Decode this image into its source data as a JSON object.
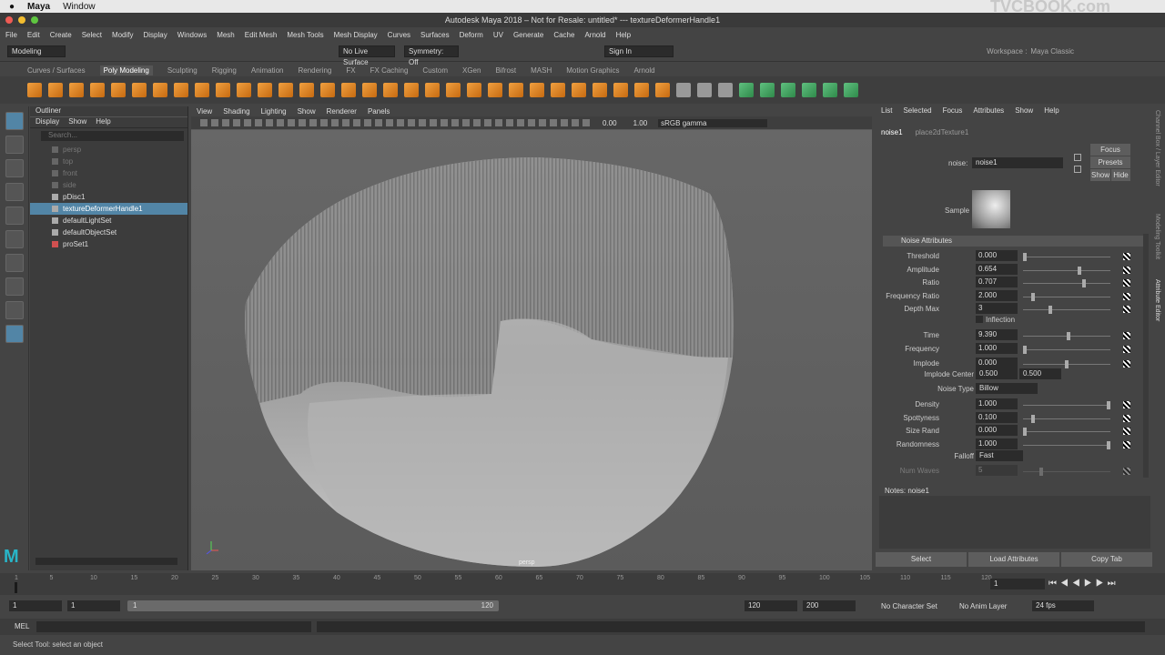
{
  "os_menu": {
    "app": "Maya",
    "window": "Window"
  },
  "title": "Autodesk Maya 2018 – Not for Resale: untitled*   ---   textureDeformerHandle1",
  "watermark": "TVCBOOK.com",
  "menu": [
    "File",
    "Edit",
    "Create",
    "Select",
    "Modify",
    "Display",
    "Windows",
    "Mesh",
    "Edit Mesh",
    "Mesh Tools",
    "Mesh Display",
    "Curves",
    "Surfaces",
    "Deform",
    "UV",
    "Generate",
    "Cache",
    "Arnold",
    "Help"
  ],
  "status": {
    "mode": "Modeling",
    "live": "No Live Surface",
    "symmetry": "Symmetry: Off",
    "signin": "Sign In",
    "workspace": "Workspace :",
    "workspace_val": "Maya Classic"
  },
  "shelf_tabs": [
    "Curves / Surfaces",
    "Poly Modeling",
    "Sculpting",
    "Rigging",
    "Animation",
    "Rendering",
    "FX",
    "FX Caching",
    "Custom",
    "XGen",
    "Bifrost",
    "MASH",
    "Motion Graphics",
    "Arnold"
  ],
  "outliner": {
    "title": "Outliner",
    "menu": [
      "Display",
      "Show",
      "Help"
    ],
    "search": "Search...",
    "items": [
      "persp",
      "top",
      "front",
      "side",
      "pDisc1",
      "textureDeformerHandle1",
      "defaultLightSet",
      "defaultObjectSet",
      "proSet1"
    ]
  },
  "viewport": {
    "menu": [
      "View",
      "Shading",
      "Lighting",
      "Show",
      "Renderer",
      "Panels"
    ],
    "v1": "0.00",
    "v2": "1.00",
    "colorspace": "sRGB gamma",
    "camera": "persp"
  },
  "attr_editor": {
    "menu": [
      "List",
      "Selected",
      "Focus",
      "Attributes",
      "Show",
      "Help"
    ],
    "tabs": [
      "noise1",
      "place2dTexture1"
    ],
    "node_label": "noise:",
    "node_name": "noise1",
    "focus": "Focus",
    "presets": "Presets",
    "show": "Show",
    "hide": "Hide",
    "sample": "Sample",
    "section": "Noise Attributes",
    "attrs": [
      {
        "label": "Threshold",
        "value": "0.000",
        "slider": 0.0
      },
      {
        "label": "Amplitude",
        "value": "0.654",
        "slider": 0.654
      },
      {
        "label": "Ratio",
        "value": "0.707",
        "slider": 0.707
      },
      {
        "label": "Frequency Ratio",
        "value": "2.000",
        "slider": 0.1
      },
      {
        "label": "Depth Max",
        "value": "3",
        "slider": 0.3
      },
      {
        "label": "Time",
        "value": "9.390",
        "slider": 0.52
      },
      {
        "label": "Frequency",
        "value": "1.000",
        "slider": 0.0
      },
      {
        "label": "Implode",
        "value": "0.000",
        "slider": 0.5
      },
      {
        "label": "Density",
        "value": "1.000",
        "slider": 1.0
      },
      {
        "label": "Spottyness",
        "value": "0.100",
        "slider": 0.1
      },
      {
        "label": "Size Rand",
        "value": "0.000",
        "slider": 0.0
      },
      {
        "label": "Randomness",
        "value": "1.000",
        "slider": 1.0
      },
      {
        "label": "Num Waves",
        "value": "5",
        "slider": 0.2
      }
    ],
    "inflection": "Inflection",
    "implode_center_label": "Implode Center",
    "ic_x": "0.500",
    "ic_y": "0.500",
    "noise_type_label": "Noise Type",
    "noise_type": "Billow",
    "falloff_label": "Falloff",
    "falloff": "Fast",
    "notes": "Notes:  noise1",
    "buttons": [
      "Select",
      "Load Attributes",
      "Copy Tab"
    ]
  },
  "timeline": {
    "ticks": [
      "1",
      "5",
      "10",
      "15",
      "20",
      "25",
      "30",
      "35",
      "40",
      "45",
      "50",
      "55",
      "60",
      "65",
      "70",
      "75",
      "80",
      "85",
      "90",
      "95",
      "100",
      "105",
      "110",
      "115",
      "120"
    ],
    "current": "1"
  },
  "range": {
    "start": "1",
    "start2": "1",
    "slider_start": "1",
    "slider_end": "120",
    "end": "120",
    "end2": "200",
    "charset": "No Character Set",
    "animlayer": "No Anim Layer",
    "fps": "24 fps"
  },
  "cmd": {
    "lang": "MEL"
  },
  "help": "Select Tool: select an object",
  "side_tabs": [
    "Channel Box / Layer Editor",
    "Modeling Toolkit",
    "Attribute Editor"
  ]
}
